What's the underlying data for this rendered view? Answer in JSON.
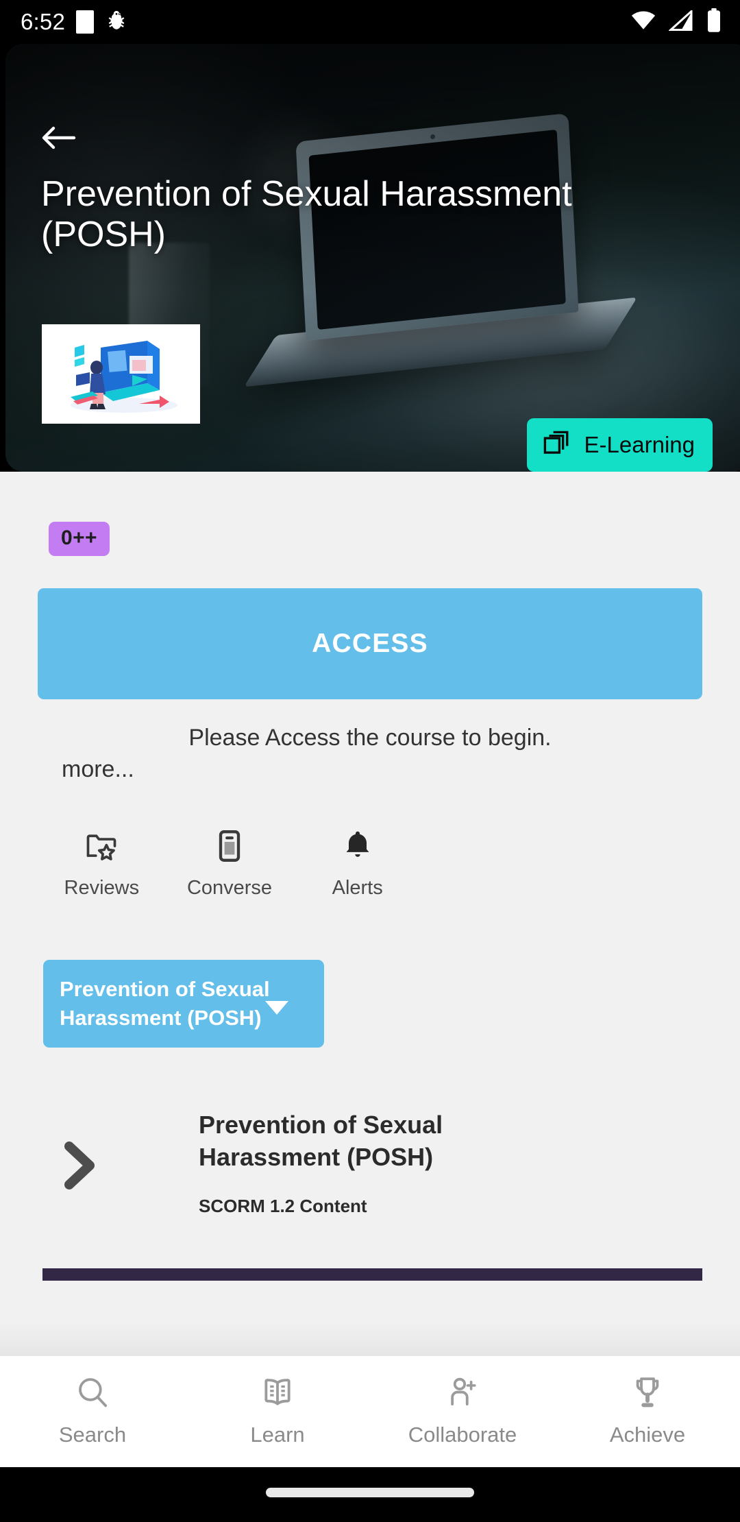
{
  "status_bar": {
    "time": "6:52",
    "icons": [
      "white-square-icon",
      "bug-icon",
      "wifi-icon",
      "cellular-signal-icon",
      "battery-icon"
    ]
  },
  "hero": {
    "back_icon": "back-arrow-icon",
    "title": "Prevention of Sexual Harassment (POSH)",
    "thumbnail_alt": "course-thumbnail",
    "type_badge": {
      "label": "E-Learning",
      "icon": "stacked-layers-icon",
      "background": "#12DFC6",
      "text_color": "#0A0A0A"
    }
  },
  "body": {
    "count_badge": {
      "label": "0++",
      "background": "#C47CF2",
      "text_color": "#1E1E1E"
    },
    "access_button": {
      "label": "ACCESS",
      "background": "#63BFE9",
      "text_color": "#FFFFFF"
    },
    "description": "Please Access the course to begin.",
    "more_link": "more...",
    "actions": [
      {
        "label": "Reviews",
        "icon": "folder-star-icon"
      },
      {
        "label": "Converse",
        "icon": "device-chat-icon"
      },
      {
        "label": "Alerts",
        "icon": "bell-icon"
      }
    ],
    "chapter_selector": {
      "label": "Prevention of Sexual Harassment (POSH)",
      "caret_icon": "chevron-down-icon",
      "background": "#63BFE9"
    },
    "content_item": {
      "expand_icon": "chevron-right-icon",
      "title": "Prevention of Sexual Harassment (POSH)",
      "subtitle": "SCORM 1.2 Content",
      "menu_icon": "three-dot-menu-icon"
    },
    "progress": {
      "percent": 100,
      "color": "#322845",
      "track_color": "#3B3050"
    }
  },
  "bottom_nav": {
    "items": [
      {
        "label": "Search",
        "icon": "magnifier-icon"
      },
      {
        "label": "Learn",
        "icon": "open-book-icon"
      },
      {
        "label": "Collaborate",
        "icon": "person-add-icon"
      },
      {
        "label": "Achieve",
        "icon": "trophy-icon"
      }
    ],
    "inactive_color": "#8A8A8A"
  },
  "gesture_bar": {
    "handle": "home-gesture-pill"
  }
}
